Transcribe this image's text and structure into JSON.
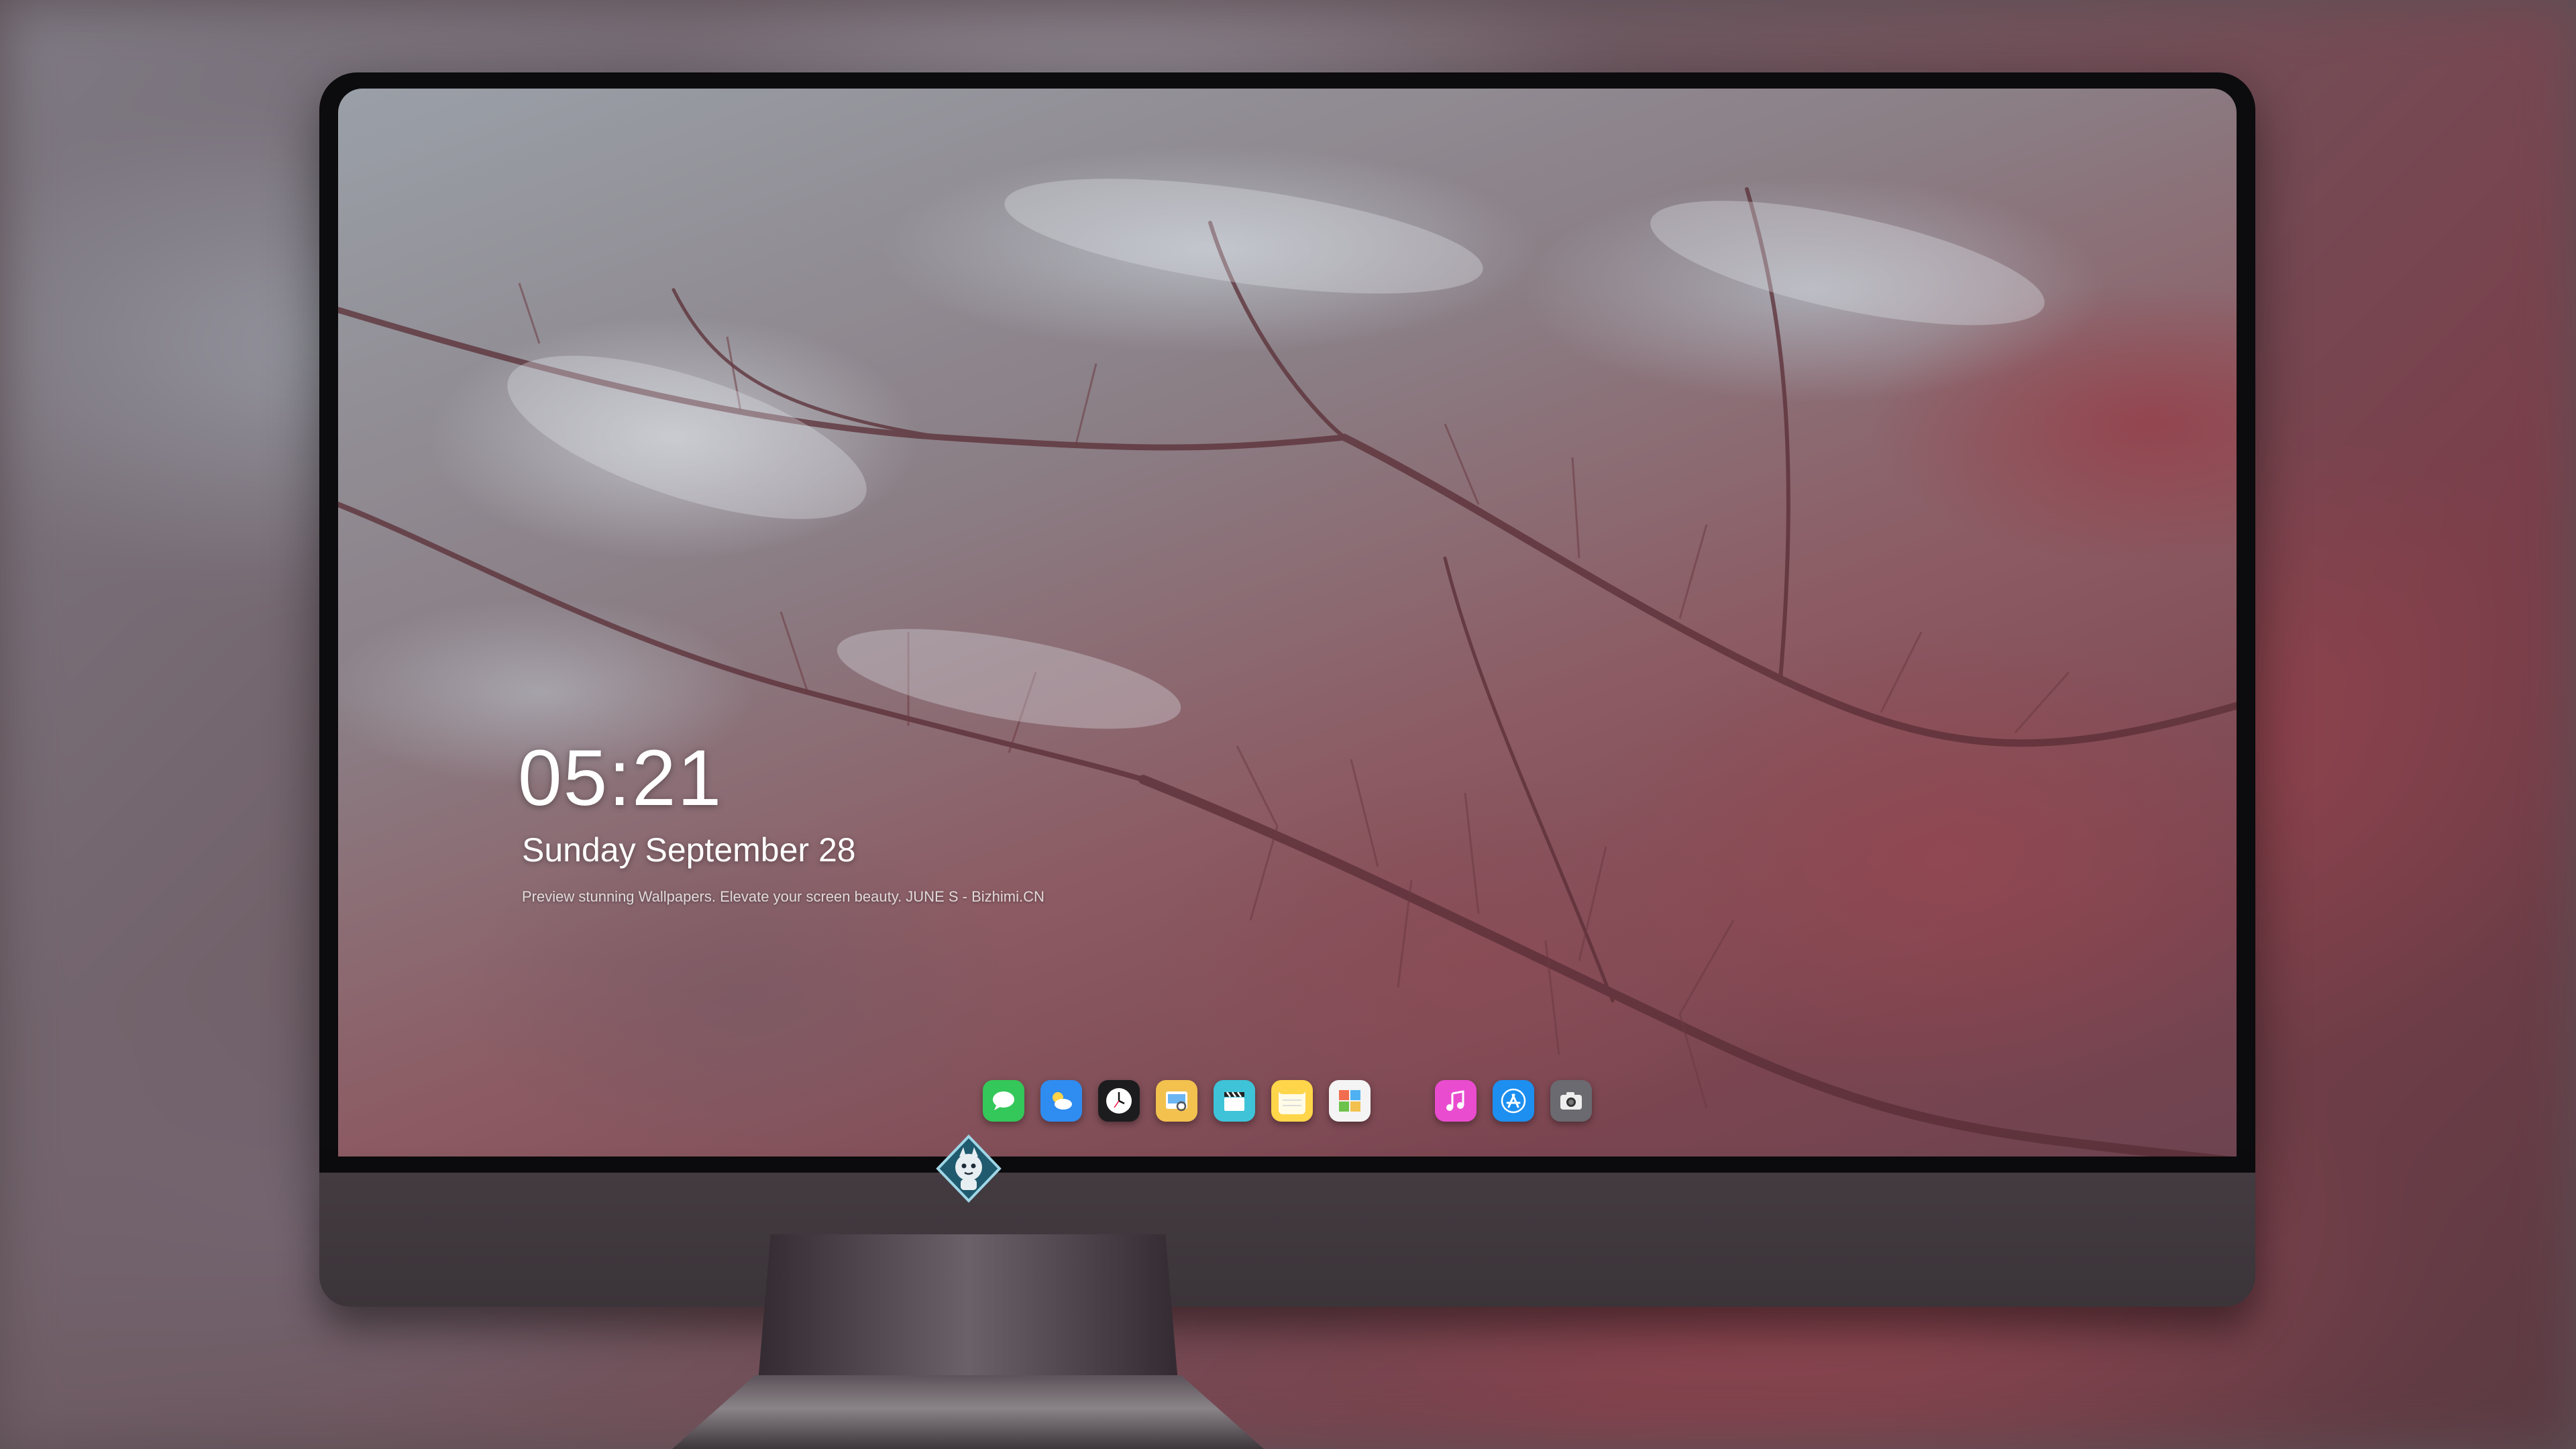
{
  "lockscreen": {
    "time": "05:21",
    "date": "Sunday September  28",
    "tagline": "Preview stunning Wallpapers. Elevate your screen beauty. JUNE S - Bizhimi.CN"
  },
  "dock": {
    "apps": [
      {
        "icon": "messages-icon",
        "color": "#34c759"
      },
      {
        "icon": "weather-icon",
        "color": "#2f8cf0"
      },
      {
        "icon": "clock-icon",
        "color": "#1c1c1e"
      },
      {
        "icon": "preview-icon",
        "color": "#f2c14e"
      },
      {
        "icon": "clapper-icon",
        "color": "#3ec3d8"
      },
      {
        "icon": "notes-icon",
        "color": "#ffd54a"
      },
      {
        "icon": "photos-icon",
        "color": "#f4f4f4"
      },
      {
        "icon": "music-icon",
        "color": "#e94ccf"
      },
      {
        "icon": "app-store-icon",
        "color": "#1d8ff0"
      },
      {
        "icon": "camera-icon",
        "color": "#6a6a70"
      }
    ]
  },
  "colors": {
    "bezel": "#0c0b0d",
    "chin": "#3f383d",
    "accent_red": "#8c5b63",
    "accent_grey": "#9aa0a8"
  }
}
